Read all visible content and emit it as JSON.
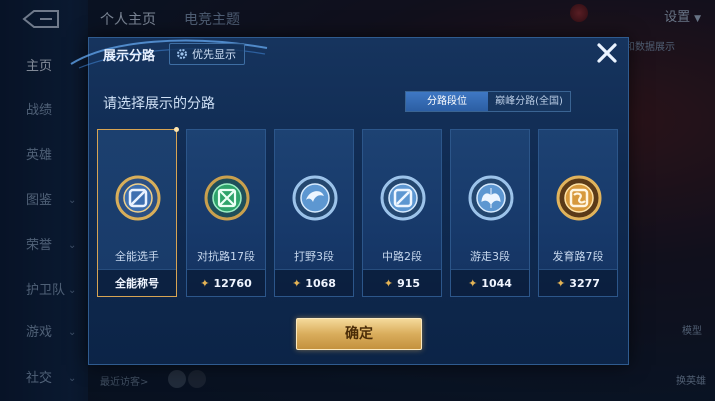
{
  "background": {
    "nav_items": [
      {
        "label": "主页",
        "active": true,
        "chevron": false
      },
      {
        "label": "战绩",
        "active": false,
        "chevron": false
      },
      {
        "label": "英雄",
        "active": false,
        "chevron": false
      },
      {
        "label": "图鉴",
        "active": false,
        "chevron": true
      },
      {
        "label": "荣誉",
        "active": false,
        "chevron": true
      },
      {
        "label": "护卫队",
        "active": false,
        "chevron": true
      },
      {
        "label": "游戏",
        "active": false,
        "chevron": true
      },
      {
        "label": "社交",
        "active": false,
        "chevron": true
      }
    ],
    "top_tabs": [
      {
        "label": "个人主页",
        "active": true
      },
      {
        "label": "电竞主题",
        "active": false
      }
    ],
    "settings_label": "设置",
    "tip_text": "更和数据展示",
    "recent_visitors": "最近访客>",
    "right_labels": {
      "model": "模型",
      "change_hero": "换英雄"
    }
  },
  "dialog": {
    "title": "展示分路",
    "priority_label": "优先显示",
    "prompt": "请选择展示的分路",
    "tabs": [
      {
        "label": "分路段位",
        "active": true
      },
      {
        "label": "巅峰分路(全国)",
        "active": false
      }
    ],
    "cards": [
      {
        "name": "全能选手",
        "stat": "全能称号",
        "show_star": false,
        "selected": true,
        "emblem": "allround-emblem-icon",
        "color": "#c9a04e"
      },
      {
        "name": "对抗路17段",
        "stat": "12760",
        "show_star": true,
        "selected": false,
        "emblem": "clash-lane-emblem-icon",
        "color": "#3fbf7a"
      },
      {
        "name": "打野3段",
        "stat": "1068",
        "show_star": true,
        "selected": false,
        "emblem": "jungle-emblem-icon",
        "color": "#6fa8dc"
      },
      {
        "name": "中路2段",
        "stat": "915",
        "show_star": true,
        "selected": false,
        "emblem": "mid-lane-emblem-icon",
        "color": "#6fa8dc"
      },
      {
        "name": "游走3段",
        "stat": "1044",
        "show_star": true,
        "selected": false,
        "emblem": "roam-emblem-icon",
        "color": "#6fa8dc"
      },
      {
        "name": "发育路7段",
        "stat": "3277",
        "show_star": true,
        "selected": false,
        "emblem": "farm-lane-emblem-icon",
        "color": "#d9a441"
      }
    ],
    "confirm_label": "确定"
  }
}
